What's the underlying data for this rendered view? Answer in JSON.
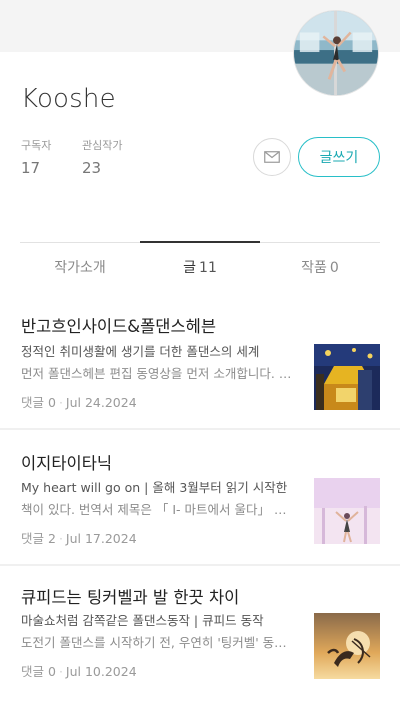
{
  "author": {
    "name": "Kooshe",
    "subscribers_label": "구독자",
    "subscribers": "17",
    "following_label": "관심작가",
    "following": "23",
    "write_label": "글쓰기"
  },
  "tabs": [
    {
      "label": "작가소개",
      "count": ""
    },
    {
      "label": "글",
      "count": "11"
    },
    {
      "label": "작품",
      "count": "0"
    }
  ],
  "posts": [
    {
      "title": "반고흐인사이드&폴댄스헤븐",
      "line1": "정적인 취미생활에 생기를 더한 폴댄스의 세계",
      "line2": "먼저 폴댄스헤븐 편집 동영상을 먼저 소개합니다. …",
      "comments": "댓글 0",
      "date": "Jul 24.2024"
    },
    {
      "title": "이지타이타닉",
      "line1": "My heart will go on | 올해 3월부터 읽기 시작한",
      "line2": "책이 있다.  번역서 제목은 「 I- 마트에서 울다」 원…",
      "comments": "댓글 2",
      "date": "Jul 17.2024"
    },
    {
      "title": "큐피드는 팅커벨과 발 한끗 차이",
      "line1": "마술쇼처럼 감쪽같은 폴댄스동작 | 큐피드 동작",
      "line2": "도전기  폴댄스를 시작하기 전, 우연히 '팅커벨' 동…",
      "comments": "댓글 0",
      "date": "Jul 10.2024"
    }
  ],
  "meta_separator": "·",
  "colors": {
    "accent": "#28bfc8",
    "top_band": "#f4f4f4",
    "divider": "#f0f0f0"
  },
  "icons": {
    "mail": "mail-icon"
  }
}
